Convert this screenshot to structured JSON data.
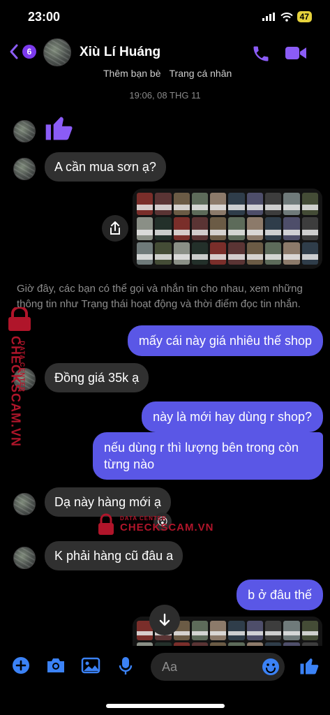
{
  "status": {
    "time": "23:00",
    "battery": "47"
  },
  "header": {
    "back_badge": "6",
    "contact_name": "Xiù Lí Huáng",
    "add_friend": "Thêm bạn bè",
    "profile_link": "Trang cá nhân",
    "timestamp": "19:06, 08 THG 11"
  },
  "messages": {
    "m1": "A cần mua sơn ạ?",
    "m2": "mấy cái này giá nhiêu thế shop",
    "m3": "Đồng giá 35k ạ",
    "m4": "này là mới hay dùng r shop?",
    "m5": "nếu dùng r thì lượng bên trong còn từng nào",
    "m6": "Dạ này hàng mới ạ",
    "m7": "K phải hàng cũ đâu a",
    "m8": "b ở đâu thế"
  },
  "info_text": "Giờ đây, các bạn có thể gọi và nhắn tin cho nhau, xem những thông tin như Trạng thái hoạt động và thời điểm đọc tin nhắn.",
  "watermark": {
    "brand": "CHECKSCAM.VN",
    "sub": "DATA CENTER"
  },
  "composer": {
    "placeholder": "Aa"
  },
  "colors": {
    "outgoing_bubble": "#5a57e6",
    "accent": "#8b5cf6",
    "incoming_bubble": "#303030"
  },
  "icons": [
    "chevron-left-icon",
    "phone-icon",
    "video-camera-icon",
    "thumbs-up-icon",
    "share-icon",
    "arrow-down-icon",
    "plus-icon",
    "camera-icon",
    "image-icon",
    "microphone-icon",
    "emoji-icon"
  ]
}
